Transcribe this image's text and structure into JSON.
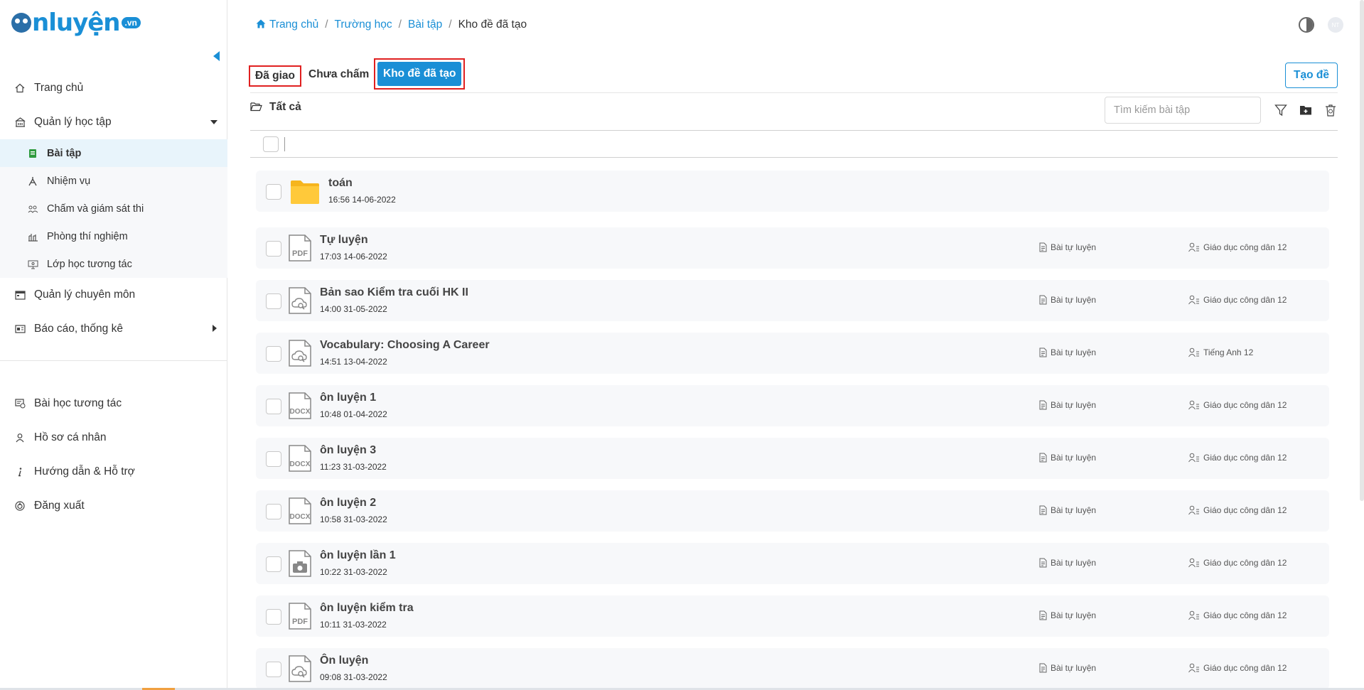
{
  "brand": {
    "logo_text": "nluyện",
    "logo_suffix": ".vn"
  },
  "header": {
    "breadcrumb": [
      "Trang chủ",
      "Trường học",
      "Bài tập",
      "Kho đề đã tạo"
    ],
    "avatar_initials": "NT"
  },
  "sidebar": {
    "items": [
      {
        "label": "Trang chủ",
        "icon": "home-icon"
      },
      {
        "label": "Quản lý học tập",
        "icon": "school-icon",
        "expanded": true
      },
      {
        "label": "Quản lý chuyên môn",
        "icon": "calendar-icon"
      },
      {
        "label": "Báo cáo, thống kê",
        "icon": "report-icon"
      }
    ],
    "sub_items": [
      {
        "label": "Bài tập",
        "icon": "book-icon",
        "active": true
      },
      {
        "label": "Nhiệm vụ",
        "icon": "compass-icon"
      },
      {
        "label": "Chấm và giám sát thi",
        "icon": "proctor-icon"
      },
      {
        "label": "Phòng thí nghiệm",
        "icon": "lab-icon"
      },
      {
        "label": "Lớp học tương tác",
        "icon": "classroom-icon"
      }
    ],
    "bottom_items": [
      {
        "label": "Bài học tương tác",
        "icon": "interactive-lesson-icon"
      },
      {
        "label": "Hồ sơ cá nhân",
        "icon": "user-icon"
      },
      {
        "label": "Hướng dẫn & Hỗ trợ",
        "icon": "info-icon"
      },
      {
        "label": "Đăng xuất",
        "icon": "power-icon"
      }
    ]
  },
  "tabs": {
    "assigned": "Đã giao",
    "ungraded": "Chưa chấm",
    "bank": "Kho đề đã tạo"
  },
  "toolbar": {
    "create_label": "Tạo đề",
    "folder_label": "Tất cả",
    "search_placeholder": "Tìm kiếm bài tập"
  },
  "accent_color": "#1a8fd6",
  "highlight_color": "#e02020",
  "rows": [
    {
      "kind": "folder",
      "title": "toán",
      "time": "16:56 14-06-2022",
      "type": "",
      "subject": ""
    },
    {
      "kind": "pdf",
      "title": "Tự luyện",
      "time": "17:03 14-06-2022",
      "type": "Bài tự luyện",
      "subject": "Giáo dục công dân 12"
    },
    {
      "kind": "online",
      "title": "Bản sao Kiểm tra cuối HK II",
      "time": "14:00 31-05-2022",
      "type": "Bài tự luyện",
      "subject": "Giáo dục công dân 12"
    },
    {
      "kind": "online",
      "title": "Vocabulary: Choosing A Career",
      "time": "14:51 13-04-2022",
      "type": "Bài tự luyện",
      "subject": "Tiếng Anh 12"
    },
    {
      "kind": "docx",
      "title": "ôn luyện 1",
      "time": "10:48 01-04-2022",
      "type": "Bài tự luyện",
      "subject": "Giáo dục công dân 12"
    },
    {
      "kind": "docx",
      "title": "ôn luyện 3",
      "time": "11:23 31-03-2022",
      "type": "Bài tự luyện",
      "subject": "Giáo dục công dân 12"
    },
    {
      "kind": "docx",
      "title": "ôn luyện 2",
      "time": "10:58 31-03-2022",
      "type": "Bài tự luyện",
      "subject": "Giáo dục công dân 12"
    },
    {
      "kind": "camera",
      "title": "ôn luyện lần 1",
      "time": "10:22 31-03-2022",
      "type": "Bài tự luyện",
      "subject": "Giáo dục công dân 12"
    },
    {
      "kind": "pdf",
      "title": "ôn luyện kiểm tra",
      "time": "10:11 31-03-2022",
      "type": "Bài tự luyện",
      "subject": "Giáo dục công dân 12"
    },
    {
      "kind": "online",
      "title": "Ôn luyện",
      "time": "09:08 31-03-2022",
      "type": "Bài tự luyện",
      "subject": "Giáo dục công dân 12"
    }
  ]
}
